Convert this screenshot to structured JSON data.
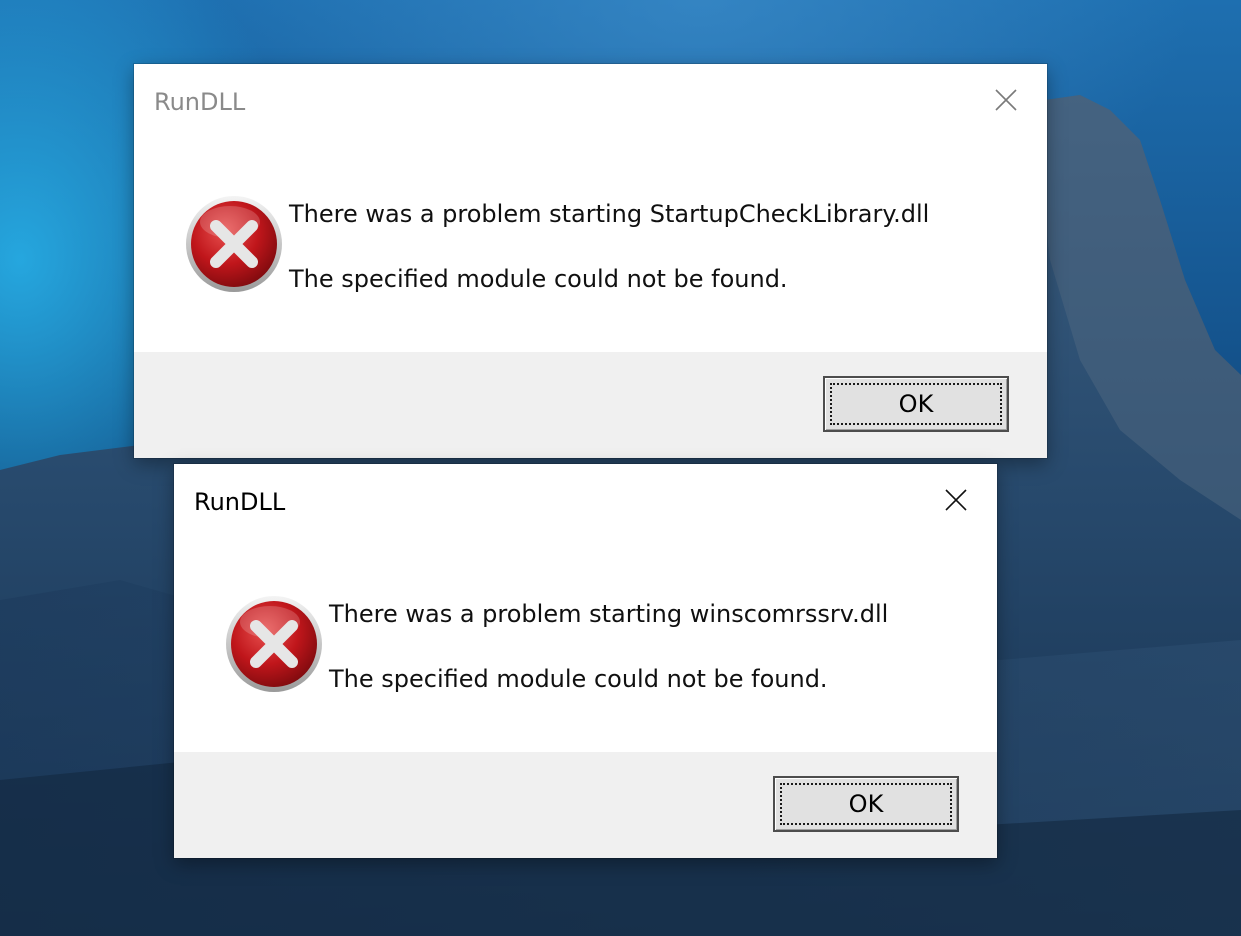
{
  "dialogs": [
    {
      "title": "RunDLL",
      "icon": "error-icon",
      "message_line1": "There was a problem starting StartupCheckLibrary.dll",
      "message_line2": "The specified module could not be found.",
      "ok_label": "OK",
      "active": false
    },
    {
      "title": "RunDLL",
      "icon": "error-icon",
      "message_line1": "There was a problem starting winscomrssrv.dll",
      "message_line2": "The specified module could not be found.",
      "ok_label": "OK",
      "active": true
    }
  ],
  "colors": {
    "error_red": "#c0161b",
    "inactive_title": "#8a8a8a",
    "footer_bg": "#f0f0f0"
  }
}
